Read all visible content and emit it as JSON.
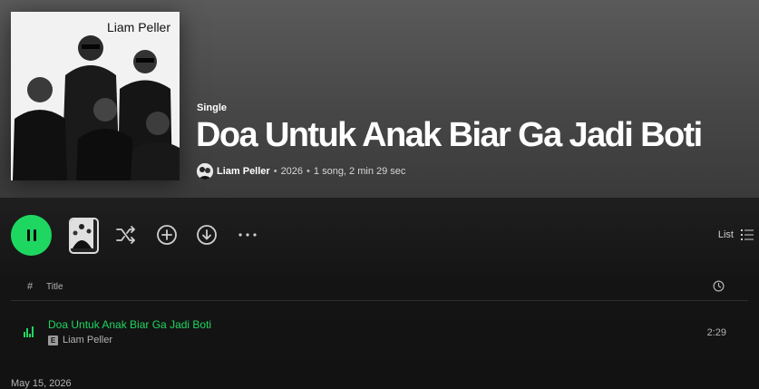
{
  "album": {
    "type_label": "Single",
    "title": "Doa Untuk Anak Biar Ga Jadi Boti",
    "cover_text": "Liam Peller",
    "artist": "Liam Peller",
    "year": "2026",
    "summary": "1 song, 2 min 29 sec",
    "separator": "•"
  },
  "controls": {
    "view_mode_label": "List",
    "more_label": "···",
    "icons": {
      "play_pause": "pause-icon",
      "shuffle": "shuffle-icon",
      "add": "plus-circle-icon",
      "download": "download-icon",
      "more": "more-icon",
      "list": "list-view-icon"
    }
  },
  "table": {
    "col_hash": "#",
    "col_title": "Title",
    "col_duration_icon": "clock-icon"
  },
  "tracks": [
    {
      "title": "Doa Untuk Anak Biar Ga Jadi Boti",
      "explicit": "E",
      "artist": "Liam Peller",
      "duration": "2:29",
      "playing_indicator": "equalizer-icon"
    }
  ],
  "release_date": "May 15, 2026",
  "colors": {
    "accent": "#1ed760",
    "background": "#121212",
    "header_gradient_top": "#5a5a5a",
    "text_secondary": "#b3b3b3"
  }
}
